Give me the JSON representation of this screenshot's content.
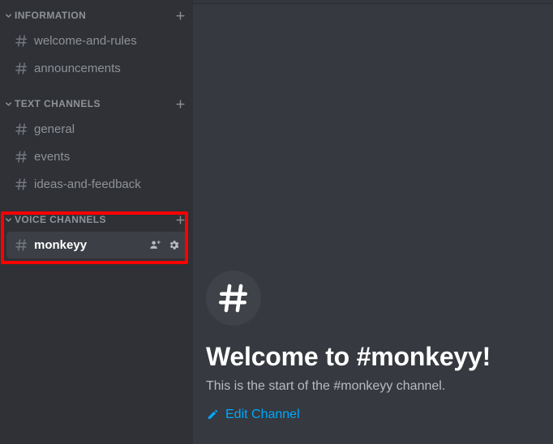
{
  "colors": {
    "sidebar_bg": "#2f3136",
    "main_bg": "#36393f",
    "active_channel_bg": "#3c3f45",
    "category_text": "#8e9297",
    "channel_text": "#8e9297",
    "active_channel_text": "#ffffff",
    "link_accent": "#00a8fc",
    "highlight_border": "#ff0000"
  },
  "sidebar": {
    "categories": [
      {
        "label": "INFORMATION",
        "chevron_icon": "chevron-down-icon",
        "add_icon": "plus-icon",
        "highlighted": false,
        "channels": [
          {
            "name": "welcome-and-rules",
            "icon": "hash-icon",
            "active": false
          },
          {
            "name": "announcements",
            "icon": "hash-icon",
            "active": false
          }
        ]
      },
      {
        "label": "TEXT CHANNELS",
        "chevron_icon": "chevron-down-icon",
        "add_icon": "plus-icon",
        "highlighted": false,
        "channels": [
          {
            "name": "general",
            "icon": "hash-icon",
            "active": false
          },
          {
            "name": "events",
            "icon": "hash-icon",
            "active": false
          },
          {
            "name": "ideas-and-feedback",
            "icon": "hash-icon",
            "active": false
          }
        ]
      },
      {
        "label": "VOICE CHANNELS",
        "chevron_icon": "chevron-down-icon",
        "add_icon": "plus-icon",
        "highlighted": true,
        "channels": [
          {
            "name": "monkeyy",
            "icon": "hash-icon",
            "active": true,
            "actions": [
              {
                "icon": "person-add-icon",
                "label": "Create Invite"
              },
              {
                "icon": "gear-icon",
                "label": "Edit Channel"
              }
            ]
          }
        ]
      }
    ]
  },
  "main": {
    "channel_avatar_icon": "hash-icon",
    "title": "Welcome to #monkeyy!",
    "subtitle": "This is the start of the #monkeyy channel.",
    "edit_channel": {
      "icon": "pencil-icon",
      "label": "Edit Channel"
    }
  }
}
